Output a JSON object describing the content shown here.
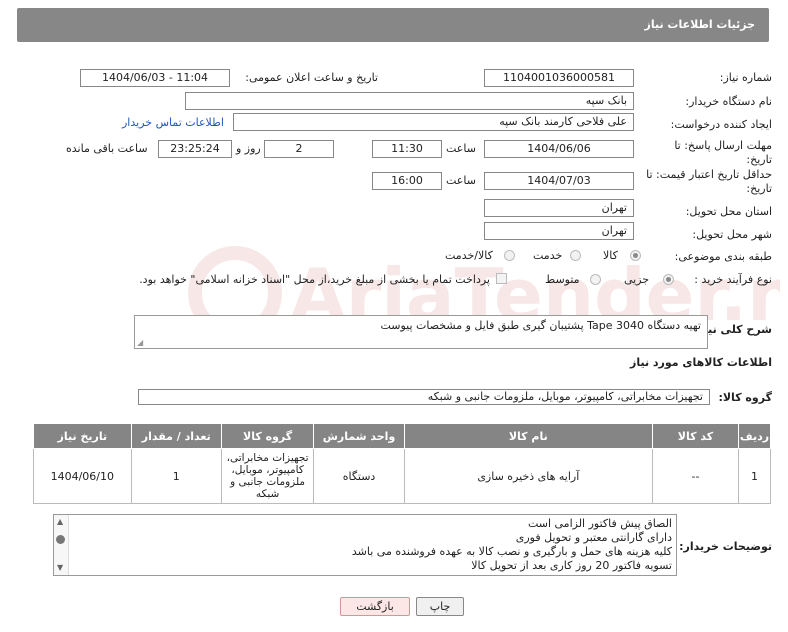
{
  "header": {
    "title": "جزئیات اطلاعات نیاز"
  },
  "fields": {
    "need_number_label": "شماره نیاز:",
    "need_number": "1104001036000581",
    "announce_label": "تاریخ و ساعت اعلان عمومی:",
    "announce_value": "1404/06/03 - 11:04",
    "buyer_org_label": "نام دستگاه خریدار:",
    "buyer_org": "بانک سپه",
    "requester_label": "ایجاد کننده درخواست:",
    "requester": "علی فلاحی کارمند بانک سپه",
    "contact_link": "اطلاعات تماس خریدار",
    "deadline_label": "مهلت ارسال پاسخ: تا تاریخ:",
    "deadline_date": "1404/06/06",
    "time_label": "ساعت",
    "deadline_time": "11:30",
    "days_value": "2",
    "days_label": "روز و",
    "remaining_time": "23:25:24",
    "remaining_label": "ساعت باقی مانده",
    "min_validity_label": "حداقل تاریخ اعتبار قیمت: تا تاریخ:",
    "validity_date": "1404/07/03",
    "validity_time_label": "ساعت",
    "validity_time": "16:00",
    "province_label": "استان محل تحویل:",
    "province": "تهران",
    "city_label": "شهر محل تحویل:",
    "city": "تهران",
    "category_label": "طبقه بندی موضوعی:",
    "category_options": [
      "کالا",
      "خدمت",
      "کالا/خدمت"
    ],
    "process_label": "نوع فرآیند خرید :",
    "process_options": [
      "جزیی",
      "متوسط"
    ],
    "payment_note": "پرداخت تمام یا بخشی از مبلغ خرید،از محل \"اسناد خزانه اسلامی\" خواهد بود.",
    "description_label": "شرح کلی نیاز:",
    "description": "تهیه دستگاه Tape 3040 پشتیبان گیری طبق فایل و مشخصات پیوست",
    "goods_info_title": "اطلاعات کالاهای مورد نیاز",
    "goods_group_label": "گروه کالا:",
    "goods_group": "تجهیزات مخابراتی، کامپیوتر، موبایل، ملزومات جانبی و شبکه"
  },
  "table": {
    "headers": [
      "ردیف",
      "کد کالا",
      "نام کالا",
      "واحد شمارش",
      "گروه کالا",
      "تعداد / مقدار",
      "تاریخ نیاز"
    ],
    "rows": [
      [
        "1",
        "--",
        "آرایه های ذخیره سازی",
        "دستگاه",
        "تجهیزات مخابراتی، کامپیوتر، موبایل، ملزومات جانبی و شبکه",
        "1",
        "1404/06/10"
      ]
    ]
  },
  "notes": {
    "label": "توضیحات خریدار:",
    "lines": [
      "الصاق پیش فاکتور  الزامی است",
      "دارای گارانتی معتبر و تحویل فوری",
      "کلیه هزینه های حمل و بارگیری و نصب کالا به عهده فروشنده می باشد",
      "تسویه فاکتور 20 روز کاری بعد از تحویل کالا"
    ]
  },
  "buttons": {
    "print": "چاپ",
    "back": "بازگشت"
  },
  "watermark": {
    "text": "AriaTender.net"
  },
  "colors": {
    "header_bg": "#878787",
    "table_header_bg": "#858585",
    "link": "#2255bb",
    "back_button_bg": "#fde6e6"
  }
}
